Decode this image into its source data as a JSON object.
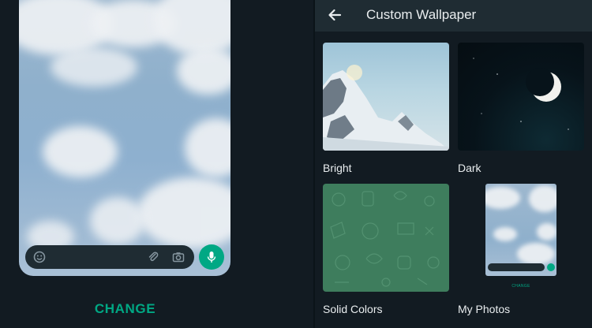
{
  "preview": {
    "change_label": "CHANGE"
  },
  "composer": {
    "emoji_icon": "emoji-icon",
    "attach_icon": "paperclip-icon",
    "camera_icon": "camera-icon",
    "mic_icon": "microphone-icon"
  },
  "header": {
    "back_icon": "arrow-left-icon",
    "title": "Custom Wallpaper"
  },
  "options": [
    {
      "label": "Bright"
    },
    {
      "label": "Dark"
    },
    {
      "label": "Solid Colors"
    },
    {
      "label": "My Photos"
    }
  ],
  "mini_preview": {
    "change_label": "CHANGE"
  },
  "colors": {
    "accent": "#00a884",
    "background": "#121b22",
    "appbar": "#1f2c33",
    "text": "#e9edef",
    "solid_tile": "#3e7d5d"
  }
}
